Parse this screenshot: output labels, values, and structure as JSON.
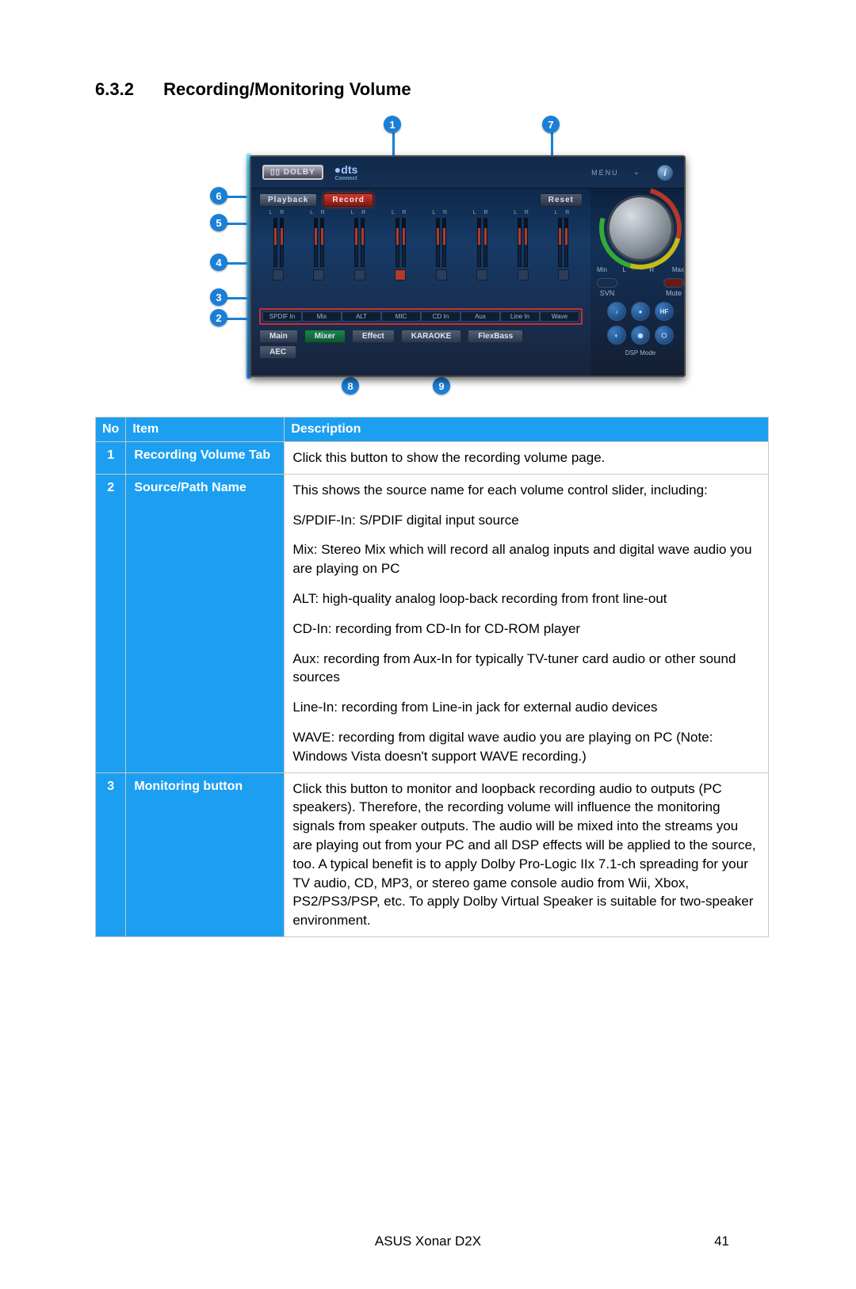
{
  "section": {
    "number": "6.3.2",
    "title": "Recording/Monitoring Volume"
  },
  "callouts": {
    "c1": "1",
    "c2": "2",
    "c3": "3",
    "c4": "4",
    "c5": "5",
    "c6": "6",
    "c7": "7",
    "c8": "8",
    "c9": "9"
  },
  "panel": {
    "dolby": "DOLBY",
    "dts": "dts",
    "dts_sub": "Connect",
    "menu": "MENU",
    "info": "i",
    "tabs": {
      "playback": "Playback",
      "record": "Record",
      "reset": "Reset"
    },
    "lr": "L  R",
    "channels": [
      "SPDIF In",
      "Mix",
      "ALT",
      "MIC",
      "CD In",
      "Aux",
      "Line In",
      "Wave"
    ],
    "bottom": {
      "main": "Main",
      "mixer": "Mixer",
      "effect": "Effect",
      "karaoke": "KARAOKE",
      "flexbass": "FlexBass",
      "aec": "AEC"
    },
    "knob": {
      "min": "Min",
      "max": "Max",
      "svn": "SVN",
      "mute": "Mute",
      "hf": "HF",
      "dsp": "DSP Mode"
    }
  },
  "table": {
    "headers": {
      "no": "No",
      "item": "Item",
      "desc": "Description"
    },
    "rows": [
      {
        "no": "1",
        "item": "Recording Volume Tab",
        "desc_paras": [
          "Click this button to show the recording volume page."
        ]
      },
      {
        "no": "2",
        "item": "Source/Path Name",
        "desc_paras": [
          "This shows the source name for each volume control slider, including:",
          "S/PDIF-In: S/PDIF digital input source",
          "Mix: Stereo Mix which will record all analog inputs and digital wave audio you are playing on PC",
          "ALT: high-quality analog loop-back recording from front line-out",
          "CD-In: recording from CD-In for CD-ROM player",
          "Aux: recording from Aux-In for typically TV-tuner card audio or other sound sources",
          "Line-In: recording from Line-in jack for external audio devices",
          "WAVE: recording from digital wave audio you are playing on PC (Note: Windows Vista doesn't support WAVE recording.)"
        ]
      },
      {
        "no": "3",
        "item": "Monitoring button",
        "desc_paras": [
          "Click this button to monitor and loopback recording audio to outputs (PC speakers). Therefore, the recording volume will influence the monitoring signals from speaker outputs. The audio will be mixed into the streams you are playing out from your PC and all DSP effects will be applied to the source, too. A typical benefit is to apply Dolby Pro-Logic IIx 7.1-ch spreading for your TV audio, CD, MP3, or stereo game console audio from Wii, Xbox, PS2/PS3/PSP, etc. To apply Dolby Virtual Speaker is suitable for two-speaker environment."
        ]
      }
    ]
  },
  "footer": {
    "product": "ASUS Xonar D2X",
    "page": "41"
  }
}
